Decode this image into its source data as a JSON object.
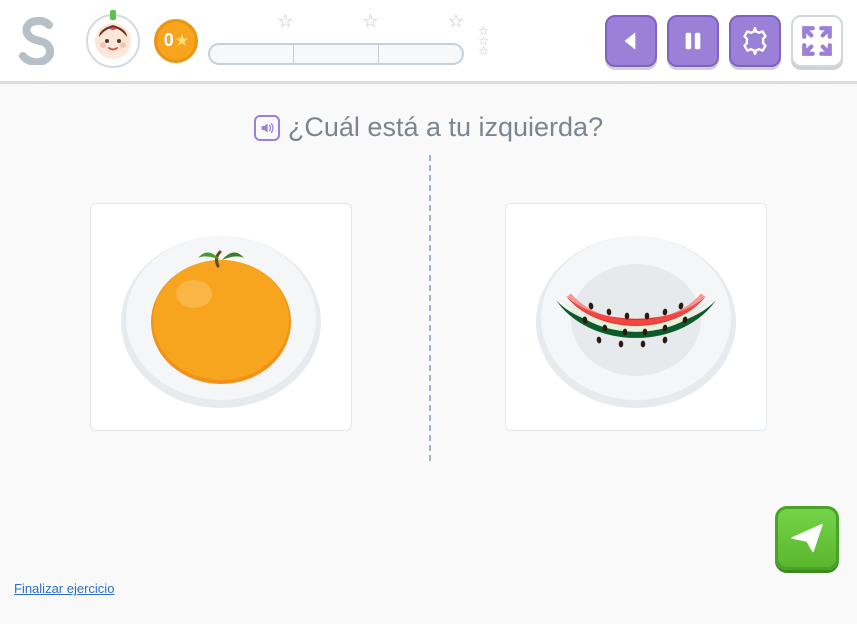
{
  "score": 0,
  "question": "¿Cuál está a tu izquierda?",
  "choices": {
    "left": "orange",
    "right": "watermelon"
  },
  "footer_link": "Finalizar ejercicio"
}
